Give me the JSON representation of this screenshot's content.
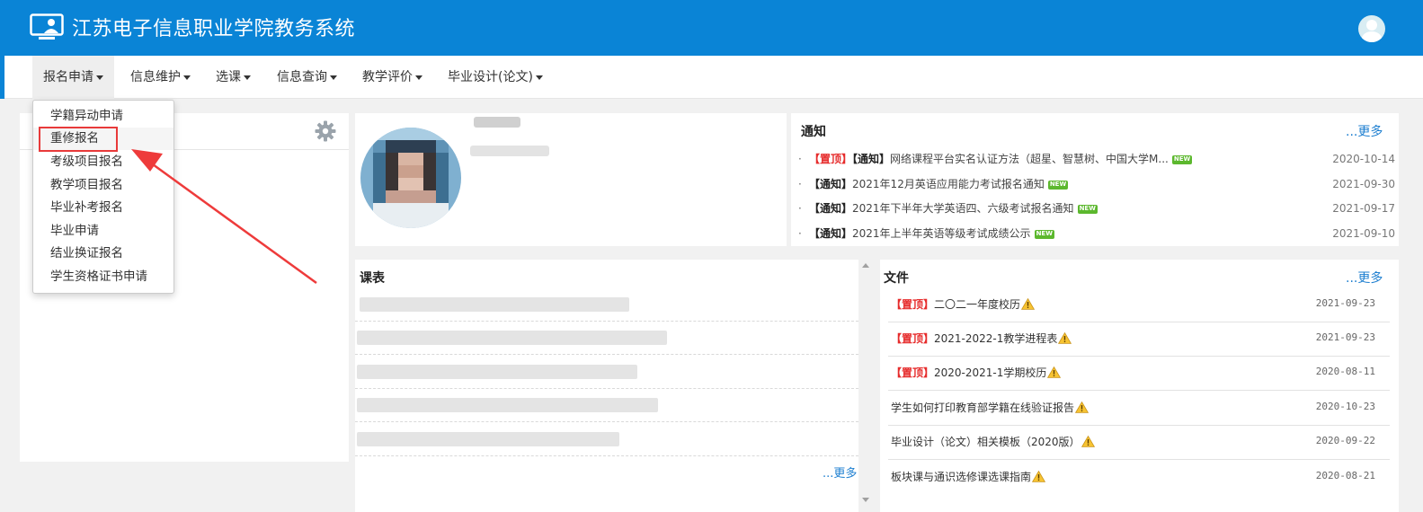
{
  "header": {
    "title": "江苏电子信息职业学院教务系统"
  },
  "nav": {
    "items": [
      {
        "label": "报名申请"
      },
      {
        "label": "信息维护"
      },
      {
        "label": "选课"
      },
      {
        "label": "信息查询"
      },
      {
        "label": "教学评价"
      },
      {
        "label": "毕业设计(论文)"
      }
    ]
  },
  "dropdown": {
    "items": [
      {
        "label": "学籍异动申请"
      },
      {
        "label": "重修报名"
      },
      {
        "label": "考级项目报名"
      },
      {
        "label": "教学项目报名"
      },
      {
        "label": "毕业补考报名"
      },
      {
        "label": "毕业申请"
      },
      {
        "label": "结业换证报名"
      },
      {
        "label": "学生资格证书申请"
      }
    ]
  },
  "notice": {
    "title": "通知",
    "more": "...更多",
    "new_badge": "NEW",
    "items": [
      {
        "tag1": "【置顶】",
        "tag2": "【通知】",
        "text": "网络课程平台实名认证方法（超星、智慧树、中国大学M...",
        "date": "2020-10-14"
      },
      {
        "tag1": "",
        "tag2": "【通知】",
        "text": "2021年12月英语应用能力考试报名通知",
        "date": "2021-09-30"
      },
      {
        "tag1": "",
        "tag2": "【通知】",
        "text": "2021年下半年大学英语四、六级考试报名通知",
        "date": "2021-09-17"
      },
      {
        "tag1": "",
        "tag2": "【通知】",
        "text": "2021年上半年英语等级考试成绩公示",
        "date": "2021-09-10"
      }
    ]
  },
  "schedule": {
    "title": "课表",
    "more": "...更多"
  },
  "files": {
    "title": "文件",
    "more": "...更多",
    "items": [
      {
        "tag": "【置顶】",
        "text": "二〇二一年度校历",
        "date": "2021-09-23"
      },
      {
        "tag": "【置顶】",
        "text": "2021-2022-1教学进程表",
        "date": "2021-09-23"
      },
      {
        "tag": "【置顶】",
        "text": "2020-2021-1学期校历",
        "date": "2020-08-11"
      },
      {
        "tag": "",
        "text": "学生如何打印教育部学籍在线验证报告",
        "date": "2020-10-23"
      },
      {
        "tag": "",
        "text": "毕业设计（论文）相关模板（2020版）",
        "date": "2020-09-22"
      },
      {
        "tag": "",
        "text": "板块课与通识选修课选课指南",
        "date": "2020-08-21"
      }
    ]
  },
  "colors": {
    "header_bg": "#0a84d6",
    "accent_red": "#e62b2b",
    "link_blue": "#1e7fd0",
    "new_green": "#5cb82e"
  }
}
